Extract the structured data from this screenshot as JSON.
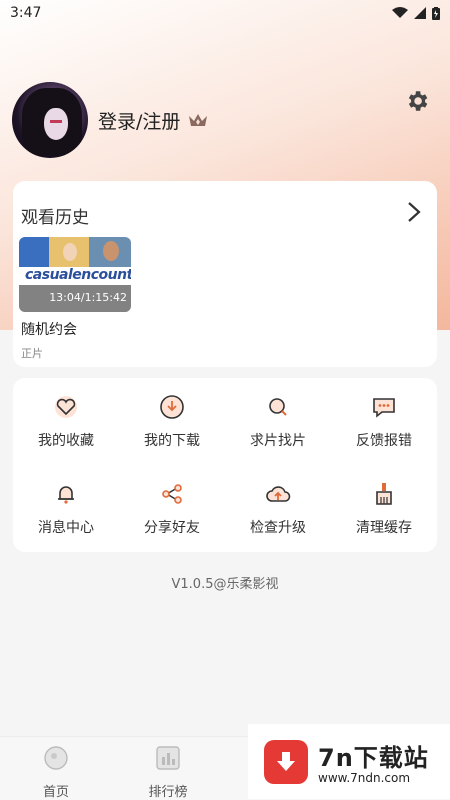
{
  "status_bar": {
    "time": "3:47"
  },
  "profile": {
    "login_label": "登录/注册"
  },
  "history": {
    "title": "观看历史",
    "item": {
      "poster_logo": "casualencounters",
      "progress": "13:04/1:15:42",
      "title": "随机约会",
      "tag": "正片"
    }
  },
  "grid": {
    "items": [
      {
        "label": "我的收藏",
        "icon": "heart-icon"
      },
      {
        "label": "我的下载",
        "icon": "download-icon"
      },
      {
        "label": "求片找片",
        "icon": "search-icon"
      },
      {
        "label": "反馈报错",
        "icon": "feedback-icon"
      },
      {
        "label": "消息中心",
        "icon": "bell-icon"
      },
      {
        "label": "分享好友",
        "icon": "share-icon"
      },
      {
        "label": "检查升级",
        "icon": "cloud-upload-icon"
      },
      {
        "label": "清理缓存",
        "icon": "broom-icon"
      }
    ]
  },
  "footer": {
    "version": "V1.0.5@乐柔影视"
  },
  "bottom_nav": {
    "items": [
      {
        "label": "首页",
        "icon": "home-icon"
      },
      {
        "label": "排行榜",
        "icon": "ranking-icon"
      }
    ]
  },
  "watermark": {
    "title": "7n下载站",
    "url": "www.7ndn.com"
  },
  "colors": {
    "accent": "#f08a5d",
    "accent_dark": "#e06b3a"
  }
}
